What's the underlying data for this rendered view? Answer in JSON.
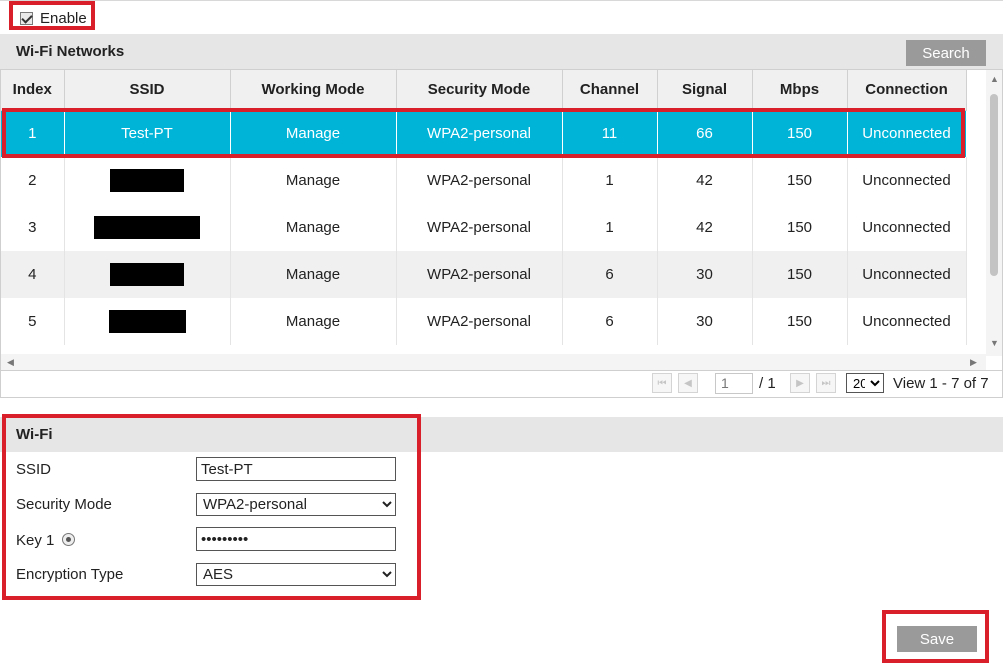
{
  "enable": {
    "label": "Enable",
    "checked": true
  },
  "networks": {
    "title": "Wi-Fi Networks",
    "search_label": "Search",
    "columns": [
      "Index",
      "SSID",
      "Working Mode",
      "Security Mode",
      "Channel",
      "Signal",
      "Mbps",
      "Connection"
    ],
    "rows": [
      {
        "index": "1",
        "ssid": "Test-PT",
        "mode": "Manage",
        "security": "WPA2-personal",
        "channel": "11",
        "signal": "66",
        "mbps": "150",
        "connection": "Unconnected",
        "selected": true
      },
      {
        "index": "2",
        "ssid": "",
        "mode": "Manage",
        "security": "WPA2-personal",
        "channel": "1",
        "signal": "42",
        "mbps": "150",
        "connection": "Unconnected",
        "selected": false
      },
      {
        "index": "3",
        "ssid": "",
        "mode": "Manage",
        "security": "WPA2-personal",
        "channel": "1",
        "signal": "42",
        "mbps": "150",
        "connection": "Unconnected",
        "selected": false
      },
      {
        "index": "4",
        "ssid": "",
        "mode": "Manage",
        "security": "WPA2-personal",
        "channel": "6",
        "signal": "30",
        "mbps": "150",
        "connection": "Unconnected",
        "selected": false
      },
      {
        "index": "5",
        "ssid": "",
        "mode": "Manage",
        "security": "WPA2-personal",
        "channel": "6",
        "signal": "30",
        "mbps": "150",
        "connection": "Unconnected",
        "selected": false
      }
    ],
    "pager": {
      "current_page": "1",
      "total": "/ 1",
      "page_size": "20",
      "view_text": "View 1 - 7 of 7"
    }
  },
  "wifi": {
    "title": "Wi-Fi",
    "ssid_label": "SSID",
    "ssid_value": "Test-PT",
    "security_label": "Security Mode",
    "security_value": "WPA2-personal",
    "key_label": "Key 1",
    "key_value": "•••••••••",
    "encryption_label": "Encryption Type",
    "encryption_value": "AES"
  },
  "save_label": "Save",
  "colors": {
    "selected_row": "#00b4d8",
    "highlight_box": "#d9202a",
    "button": "#9a9a9a"
  }
}
